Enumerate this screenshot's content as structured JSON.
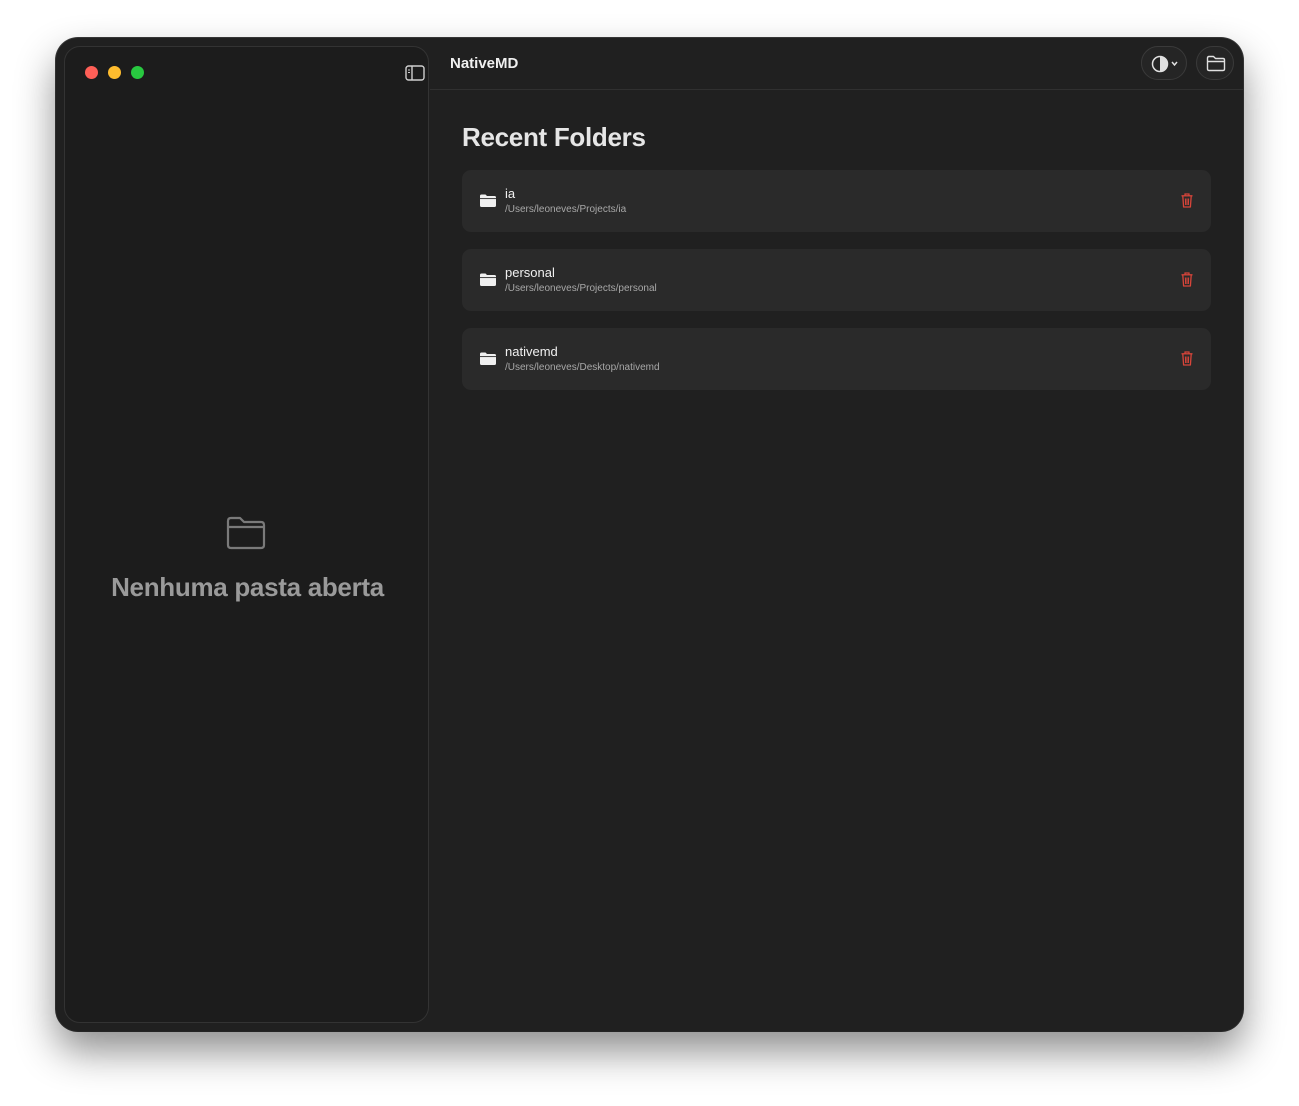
{
  "app": {
    "title": "NativeMD"
  },
  "sidebar": {
    "empty_message": "Nenhuma pasta aberta"
  },
  "main": {
    "heading": "Recent Folders",
    "folders": [
      {
        "name": "ia",
        "path": "/Users/leoneves/Projects/ia"
      },
      {
        "name": "personal",
        "path": "/Users/leoneves/Projects/personal"
      },
      {
        "name": "nativemd",
        "path": "/Users/leoneves/Desktop/nativemd"
      }
    ]
  },
  "colors": {
    "window_bg": "#202020",
    "sidebar_bg": "#1c1c1c",
    "card_bg": "#2a2a2a",
    "delete_red": "#d8453a",
    "traffic_close": "#fe5f57",
    "traffic_minimize": "#febc2e",
    "traffic_zoom": "#28c840"
  },
  "icons": {
    "sidebar_toggle": "sidebar-left-icon",
    "theme": "half-circle-contrast-icon",
    "open_folder": "folder-icon",
    "delete": "trash-icon"
  }
}
